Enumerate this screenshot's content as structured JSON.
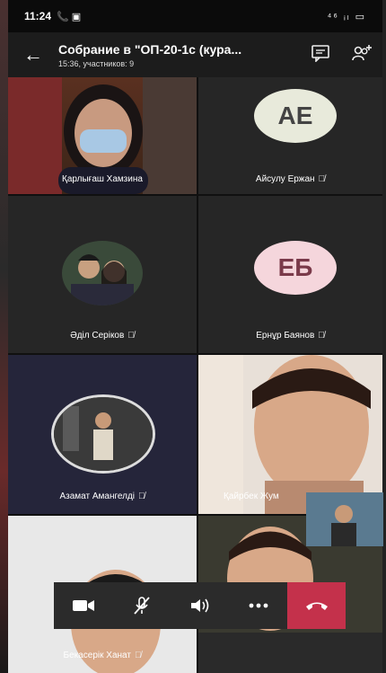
{
  "status_bar": {
    "time": "11:24",
    "left_icons": "📞 ▣",
    "right_icons": "⁴⁶ ᵢₗ ▭"
  },
  "header": {
    "back_icon": "arrow-left-icon",
    "title": "Собрание в \"ОП-20-1с (кура...",
    "subtitle": "15:36, участников: 9",
    "chat_icon": "chat-icon",
    "participants_icon": "add-people-icon"
  },
  "participants": [
    {
      "name": "Қарлығаш Хамзина",
      "muted": false
    },
    {
      "name": "Айсулу Ержан",
      "initials": "АЕ",
      "muted": true
    },
    {
      "name": "Әділ Серіков",
      "muted": true
    },
    {
      "name": "Ернұр Баянов",
      "initials": "ЕБ",
      "muted": true
    },
    {
      "name": "Азамат Амангелді",
      "muted": true
    },
    {
      "name": "Қайрбек Жум",
      "muted": false
    },
    {
      "name": "Бекасерік Ханат",
      "muted": true
    },
    {
      "name": "",
      "muted": false
    }
  ],
  "controls": {
    "camera": "camera-icon",
    "mic": "mic-off-icon",
    "speaker": "speaker-icon",
    "more": "more-icon",
    "hangup": "hangup-icon"
  },
  "colors": {
    "hangup": "#c4314b",
    "avatar_ae": "#e8eadb",
    "avatar_eb": "#f5d6dc"
  }
}
